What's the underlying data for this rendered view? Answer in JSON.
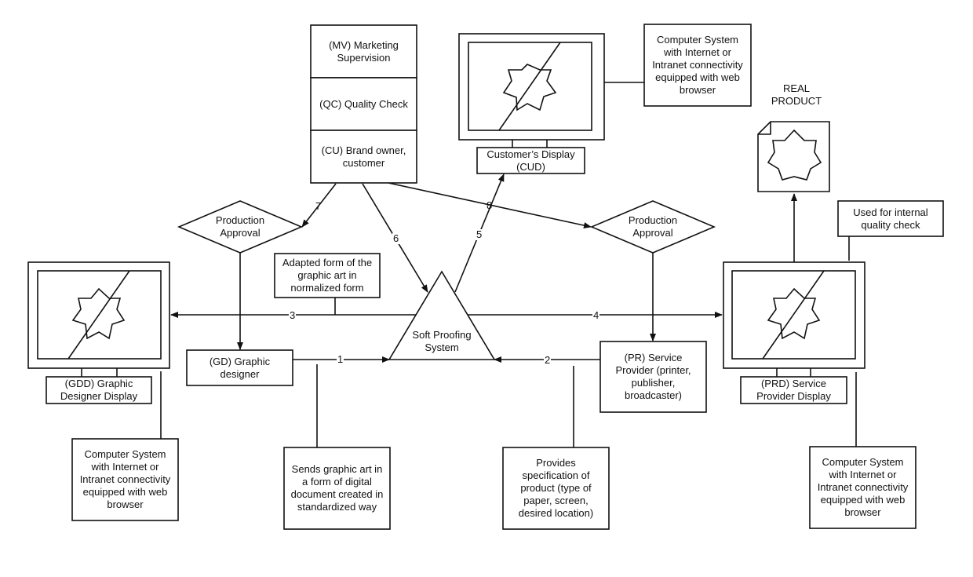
{
  "stack": {
    "mv": "(MV) Marketing\nSupervision",
    "qc": "(QC) Quality Check",
    "cu": "(CU) Brand owner,\ncustomer"
  },
  "customer_display": "Customer’s Display\n(CUD)",
  "computer_system_note": "Computer System\nwith Internet or\nIntranet connectivity\nequipped with web\nbrowser",
  "real_product": "REAL\nPRODUCT",
  "internal_qc_note": "Used for internal\nquality check",
  "approval_left": "Production\nApproval",
  "approval_right": "Production\nApproval",
  "adapted_note": "Adapted form of the\ngraphic art in\nnormalized form",
  "soft_proofing": "Soft Proofing\nSystem",
  "graphic_designer": "(GD) Graphic\ndesigner",
  "service_provider": "(PR) Service\nProvider (printer,\npublisher,\nbroadcaster)",
  "gdd": "(GDD) Graphic\nDesigner Display",
  "prd": "(PRD) Service\nProvider Display",
  "sends_note": "Sends graphic art in\na form of digital\ndocument created in\nstandardized way",
  "provides_note": "Provides\nspecification of\nproduct (type of\npaper, screen,\ndesired location)",
  "flow_labels": [
    "1",
    "2",
    "3",
    "4",
    "5",
    "6",
    "7",
    "8"
  ]
}
